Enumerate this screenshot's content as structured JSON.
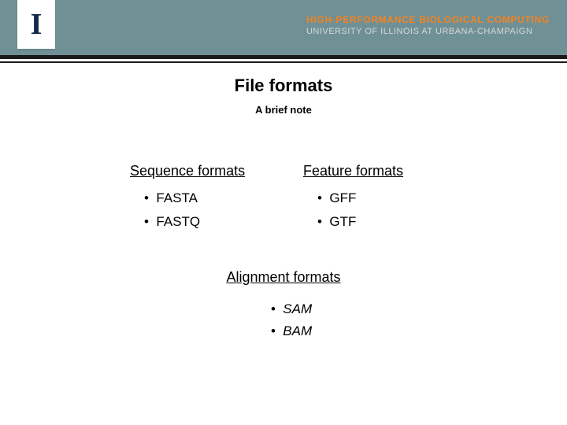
{
  "header": {
    "logo_letter": "I",
    "line1": "HIGH-PERFORMANCE BIOLOGICAL COMPUTING",
    "line2": "UNIVERSITY OF ILLINOIS AT URBANA-CHAMPAIGN"
  },
  "slide": {
    "title": "File formats",
    "subtitle": "A brief note",
    "left_column": {
      "heading": "Sequence formats",
      "items": [
        "FASTA",
        "FASTQ"
      ]
    },
    "right_column": {
      "heading": "Feature formats",
      "items": [
        "GFF",
        "GTF"
      ]
    },
    "bottom_block": {
      "heading": "Alignment formats",
      "items": [
        "SAM",
        "BAM"
      ]
    }
  }
}
